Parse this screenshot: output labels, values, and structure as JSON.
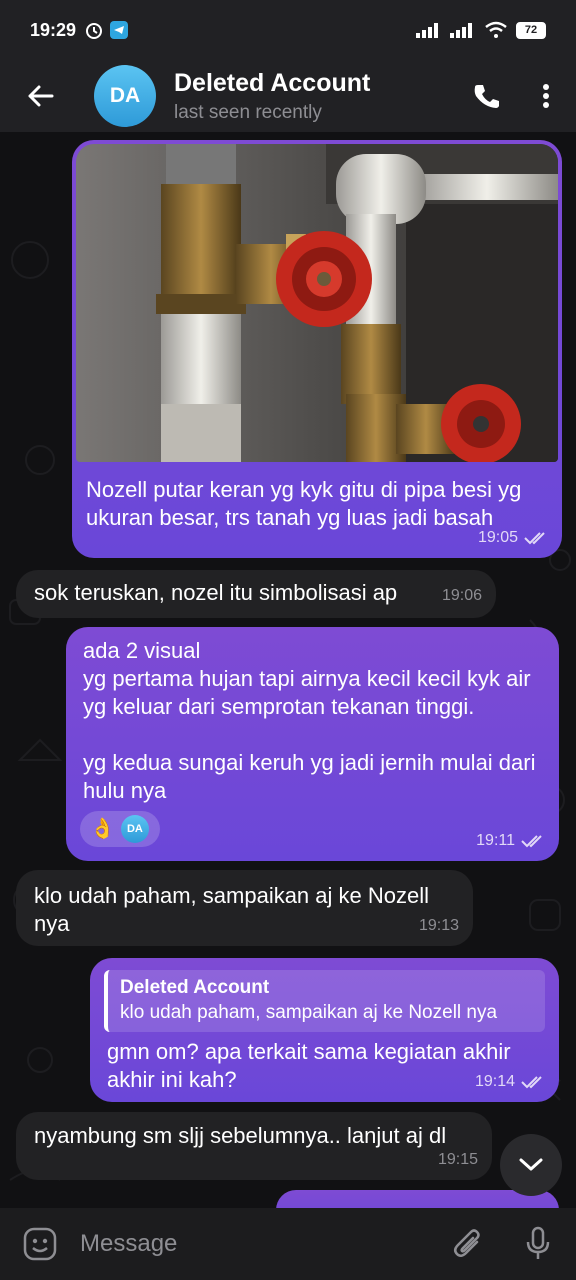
{
  "status_bar": {
    "time": "19:29",
    "battery": "72"
  },
  "header": {
    "avatar_initials": "DA",
    "title": "Deleted Account",
    "subtitle": "last seen recently"
  },
  "messages": [
    {
      "direction": "out",
      "has_photo": true,
      "text": "Nozell putar keran yg kyk gitu di pipa besi yg ukuran besar, trs tanah yg luas jadi basah",
      "time": "19:05",
      "read": true
    },
    {
      "direction": "in",
      "text": "sok teruskan, nozel itu simbolisasi ap",
      "time": "19:06"
    },
    {
      "direction": "out",
      "text": "ada 2 visual\nyg pertama hujan tapi airnya kecil kecil kyk air yg keluar dari semprotan tekanan tinggi.\n\nyg kedua sungai keruh yg jadi jernih mulai dari hulu nya",
      "reaction": {
        "emoji": "👌",
        "avatar_initials": "DA"
      },
      "time": "19:11",
      "read": true
    },
    {
      "direction": "in",
      "text": "klo udah paham, sampaikan aj ke Nozell nya",
      "time": "19:13"
    },
    {
      "direction": "out",
      "reply": {
        "name": "Deleted Account",
        "text": "klo udah paham, sampaikan aj ke Nozell nya"
      },
      "text": "gmn om? apa terkait sama kegiatan akhir akhir ini kah?",
      "time": "19:14",
      "read": true
    },
    {
      "direction": "in",
      "text": "nyambung sm sljj sebelumnya.. lanjut aj dl",
      "time": "19:15"
    }
  ],
  "input": {
    "placeholder": "Message"
  },
  "colors": {
    "outgoing_bubble": "#7049d6",
    "incoming_bubble": "#222224",
    "header": "#212124",
    "avatar": "#3aaae6"
  },
  "icons": [
    "back-arrow-icon",
    "phone-icon",
    "more-vert-icon",
    "emoji-icon",
    "attach-icon",
    "mic-icon",
    "chevron-down-icon",
    "double-check-icon",
    "alarm-icon",
    "telegram-icon",
    "signal-icon",
    "wifi-icon"
  ]
}
